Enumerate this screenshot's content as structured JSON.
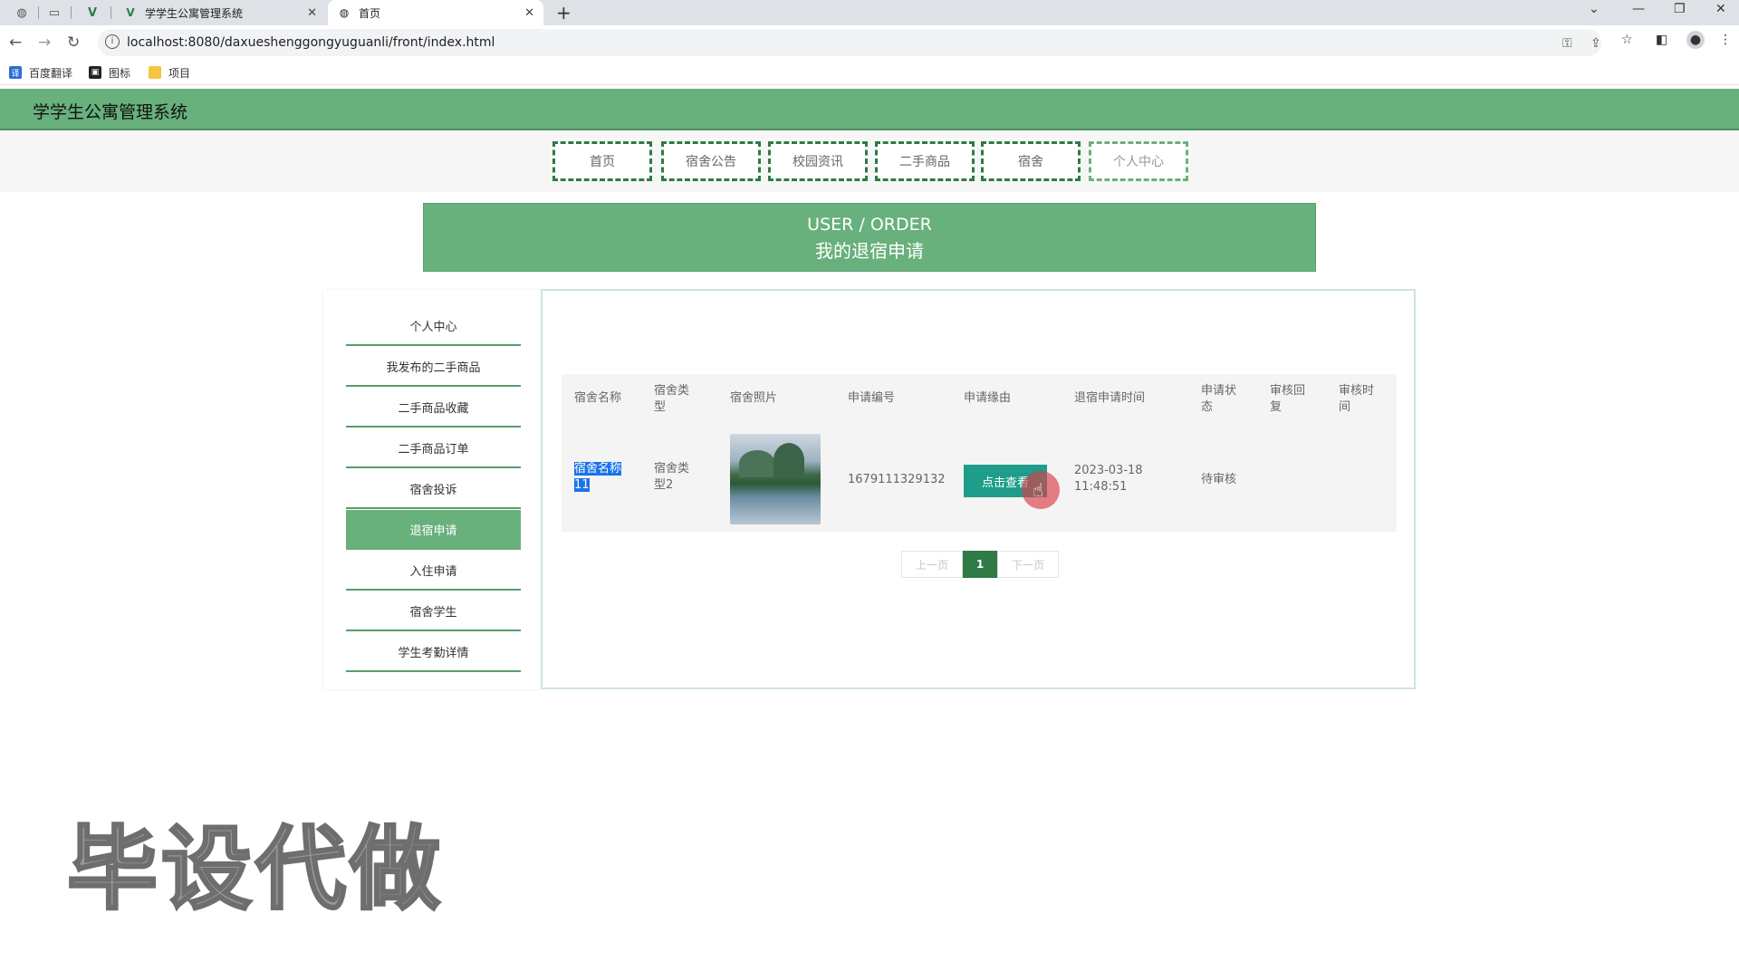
{
  "browser": {
    "tabs": [
      {
        "title": "学学生公寓管理系统"
      },
      {
        "title": "首页"
      }
    ],
    "url": "localhost:8080/daxueshenggongyuguanli/front/index.html",
    "bookmarks": [
      "百度翻译",
      "图标",
      "项目"
    ]
  },
  "site": {
    "title": "学学生公寓管理系统"
  },
  "nav": [
    "首页",
    "宿舍公告",
    "校园资讯",
    "二手商品",
    "宿舍",
    "个人中心"
  ],
  "banner": {
    "en": "USER / ORDER",
    "zh": "我的退宿申请"
  },
  "sidemenu": [
    "个人中心",
    "我发布的二手商品",
    "二手商品收藏",
    "二手商品订单",
    "宿舍投诉",
    "退宿申请",
    "入住申请",
    "宿舍学生",
    "学生考勤详情"
  ],
  "table": {
    "headers": [
      "宿舍名称",
      "宿舍类型",
      "宿舍照片",
      "申请编号",
      "申请缘由",
      "退宿申请时间",
      "申请状态",
      "审核回复",
      "审核时间"
    ],
    "rows": [
      {
        "name": "宿舍名称11",
        "type": "宿舍类型2",
        "number": "1679111329132",
        "reason_button": "点击查看",
        "time": "2023-03-18 11:48:51",
        "status": "待审核",
        "reply": "",
        "review_time": ""
      }
    ]
  },
  "pagination": {
    "prev": "上一页",
    "current": "1",
    "next": "下一页"
  },
  "watermark": "毕设代做"
}
